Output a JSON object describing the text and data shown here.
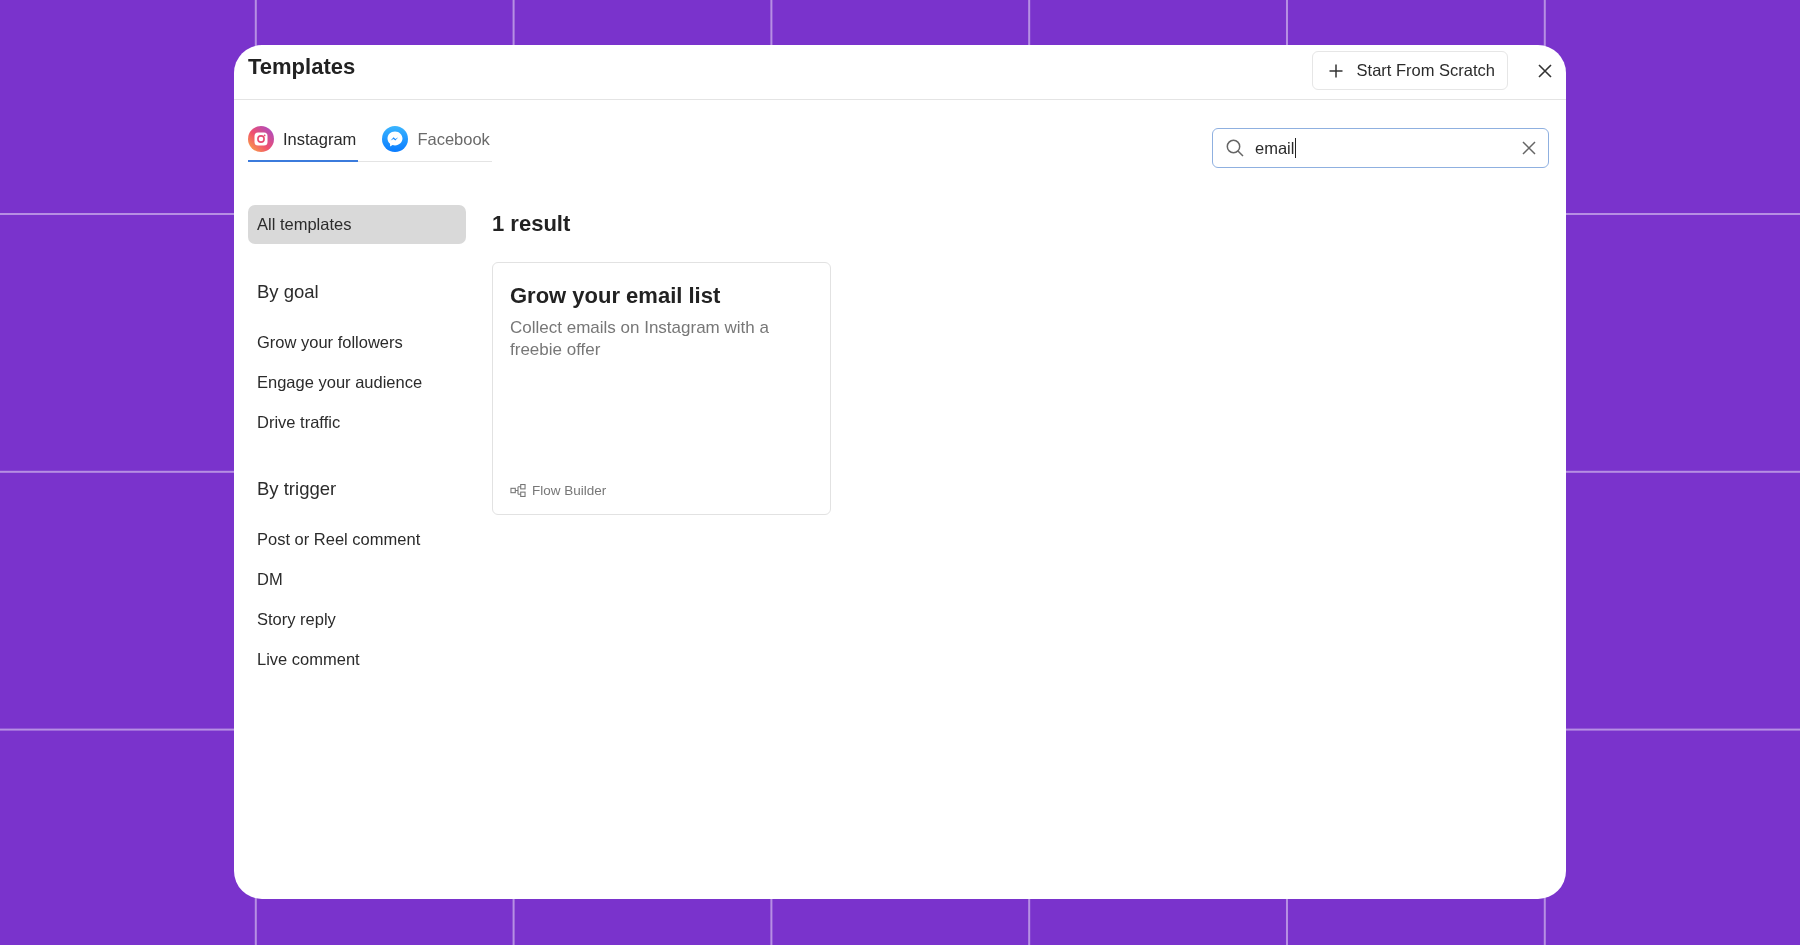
{
  "window": {
    "title": "Templates"
  },
  "header": {
    "new_button": {
      "label": "Start From Scratch"
    }
  },
  "tabs": [
    {
      "label": "Instagram",
      "kind": "instagram",
      "selected": true
    },
    {
      "label": "Facebook",
      "kind": "messenger",
      "selected": false
    }
  ],
  "search": {
    "value": "email"
  },
  "sidebar": {
    "all": {
      "label": "All templates",
      "selected": true
    },
    "groups": [
      {
        "title": "By goal",
        "items": [
          {
            "label": "Grow your followers",
            "selected": false
          },
          {
            "label": "Engage your audience",
            "selected": false
          },
          {
            "label": "Drive traffic",
            "selected": false
          }
        ]
      },
      {
        "title": "By trigger",
        "items": [
          {
            "label": "Post or Reel comment",
            "selected": false
          },
          {
            "label": "DM",
            "selected": false
          },
          {
            "label": "Story reply",
            "selected": false
          },
          {
            "label": "Live comment",
            "selected": false
          }
        ]
      }
    ]
  },
  "results": {
    "count": "1 result",
    "cards": [
      {
        "title": "Grow your email list",
        "description": "Collect emails on Instagram with a freebie offer",
        "footer": "Flow Builder"
      }
    ]
  }
}
